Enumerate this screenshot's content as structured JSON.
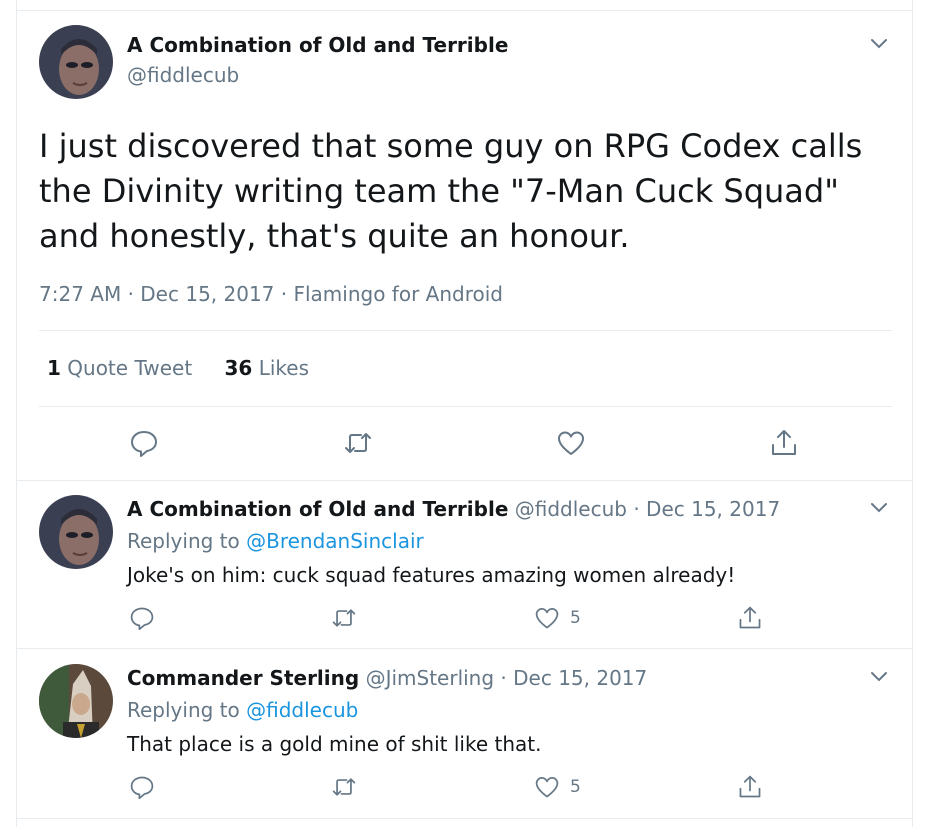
{
  "main_tweet": {
    "display_name": "A Combination of Old and Terrible",
    "handle": "@fiddlecub",
    "text": "I just discovered that some guy on RPG Codex calls the Divinity writing team the \"7-Man Cuck Squad\" and honestly, that's quite an honour.",
    "time": "7:27 AM · Dec 15, 2017 · Flamingo for Android",
    "quote_count": "1",
    "quote_label": "Quote Tweet",
    "like_count": "36",
    "like_label": "Likes"
  },
  "replies": [
    {
      "display_name": "A Combination of Old and Terrible",
      "handle": "@fiddlecub",
      "date": "· Dec 15, 2017",
      "replying_prefix": "Replying to",
      "replying_to": "@BrendanSinclair",
      "text": "Joke's on him: cuck squad features amazing women already!",
      "likes": "5"
    },
    {
      "display_name": "Commander Sterling",
      "handle": "@JimSterling",
      "date": "· Dec 15, 2017",
      "replying_prefix": "Replying to",
      "replying_to": "@fiddlecub",
      "text": "That place is a gold mine of shit like that.",
      "likes": "5"
    }
  ],
  "icons": {
    "reply": "reply-icon",
    "retweet": "retweet-icon",
    "like": "heart-icon",
    "share": "share-icon",
    "more": "chevron-down-icon"
  },
  "colors": {
    "link": "#1b95e0",
    "muted": "#657786",
    "text": "#14171a",
    "border": "#e6ecf0"
  }
}
